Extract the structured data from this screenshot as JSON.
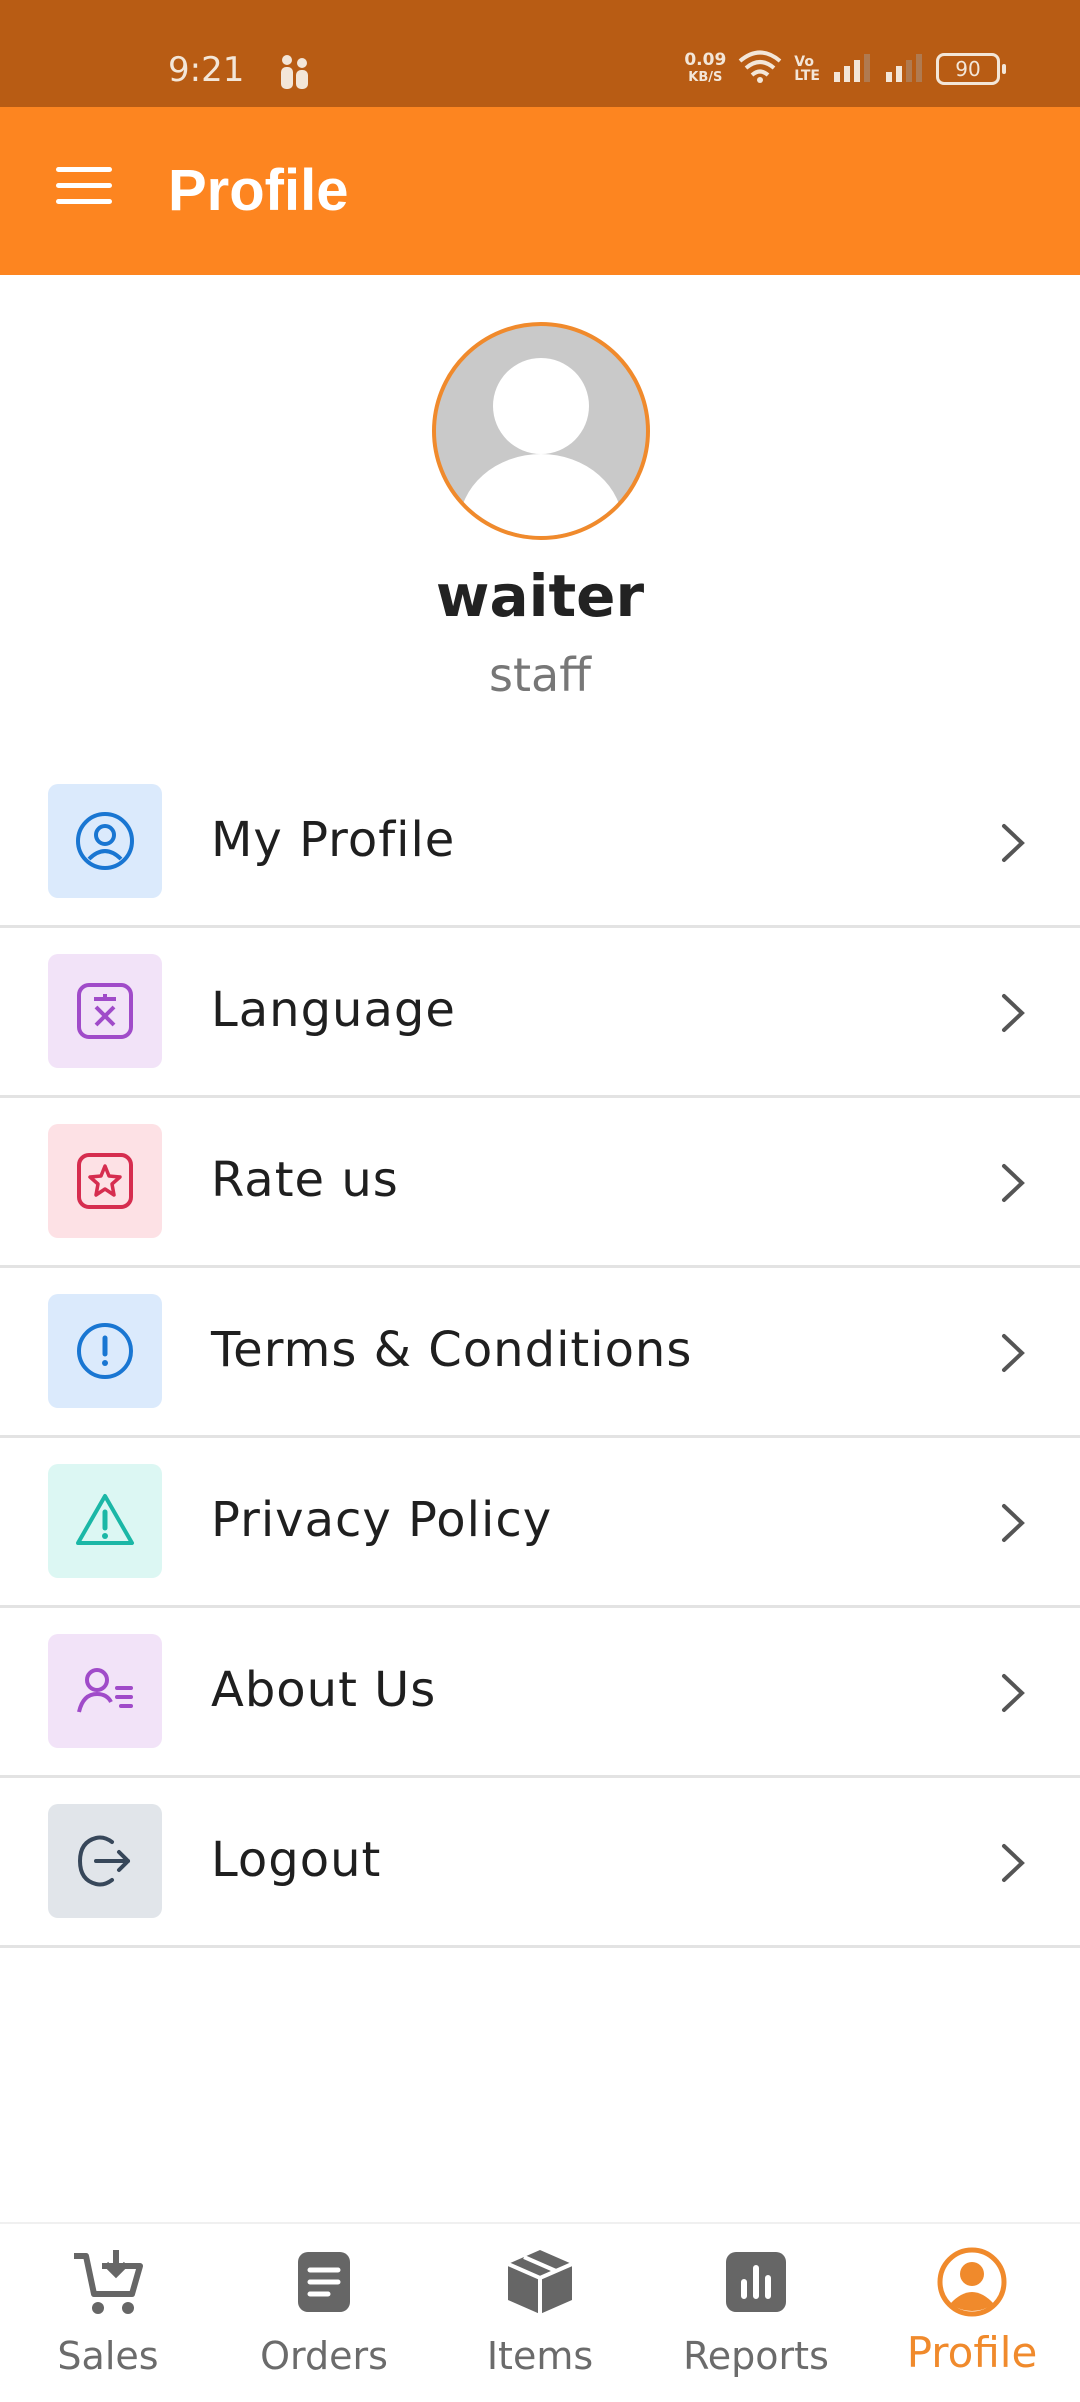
{
  "status_bar": {
    "time": "9:21",
    "net_speed_value": "0.09",
    "net_speed_unit": "KB/S",
    "volte_top": "Vo",
    "volte_bottom": "LTE",
    "battery": "90"
  },
  "app_bar": {
    "title": "Profile"
  },
  "profile": {
    "name": "waiter",
    "role": "staff"
  },
  "menu": {
    "items": [
      {
        "label": "My Profile",
        "icon": "user-circle-icon",
        "color": "#1976d2",
        "bg": "#dbeafc"
      },
      {
        "label": "Language",
        "icon": "translate-icon",
        "color": "#a04bc9",
        "bg": "#f2e3f8"
      },
      {
        "label": "Rate us",
        "icon": "star-icon",
        "color": "#d62d4f",
        "bg": "#fde1e5"
      },
      {
        "label": "Terms & Conditions",
        "icon": "info-circle-icon",
        "color": "#1976d2",
        "bg": "#dbeafc"
      },
      {
        "label": "Privacy Policy",
        "icon": "warning-triangle-icon",
        "color": "#1bb7a6",
        "bg": "#dcf7f3"
      },
      {
        "label": "About Us",
        "icon": "user-list-icon",
        "color": "#a04bc9",
        "bg": "#f2e3f8"
      },
      {
        "label": "Logout",
        "icon": "logout-icon",
        "color": "#37475a",
        "bg": "#e1e5ea"
      }
    ]
  },
  "bottom_nav": {
    "items": [
      {
        "label": "Sales",
        "icon": "cart-icon"
      },
      {
        "label": "Orders",
        "icon": "orders-icon"
      },
      {
        "label": "Items",
        "icon": "box-icon"
      },
      {
        "label": "Reports",
        "icon": "reports-icon"
      },
      {
        "label": "Profile",
        "icon": "profile-icon",
        "active": true
      }
    ],
    "active_color": "#f08a2c",
    "inactive_color": "#6b6b6b"
  }
}
